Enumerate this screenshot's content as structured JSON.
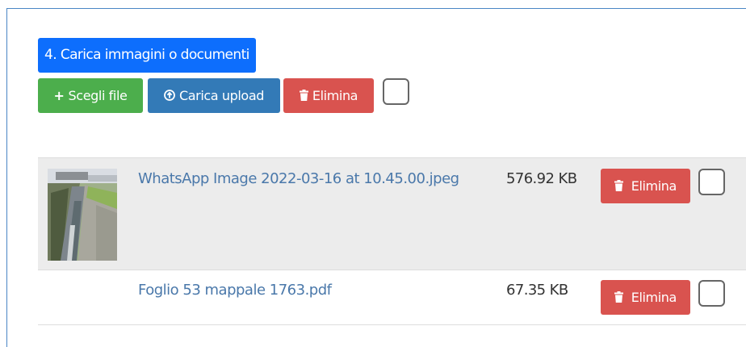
{
  "upload_section": {
    "title": "4. Carica immagini o documenti",
    "choose_label": "Scegli file",
    "choose_icon": "plus-icon",
    "upload_label": "Carica upload",
    "upload_icon": "upload-circle-icon",
    "delete_label": "Elimina",
    "delete_icon": "trash-icon"
  },
  "files": [
    {
      "name": "WhatsApp Image 2022-03-16 at 10.45.00.jpeg",
      "size": "576.92 KB",
      "delete_label": "Elimina",
      "has_thumbnail": true
    },
    {
      "name": "Foglio 53 mappale 1763.pdf",
      "size": "67.35 KB",
      "delete_label": "Elimina",
      "has_thumbnail": false
    }
  ],
  "colors": {
    "title_bg": "#0d6efd",
    "green": "#4cae4c",
    "blue": "#337ab7",
    "red": "#d9534f",
    "link": "#4a78aa",
    "row_highlight": "#ececec"
  }
}
